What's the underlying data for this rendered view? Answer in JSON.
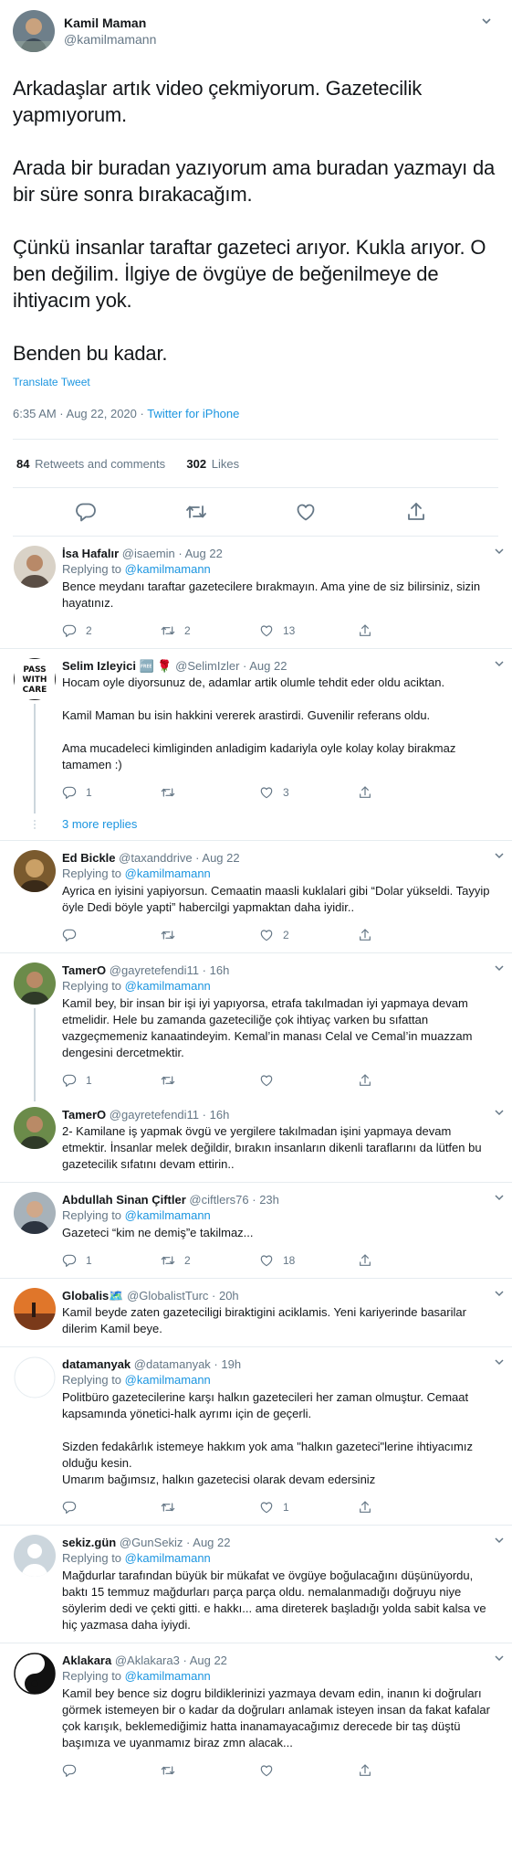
{
  "main_tweet": {
    "author_name": "Kamil Maman",
    "author_handle": "@kamilmamann",
    "paragraphs": [
      "Arkadaşlar artık video çekmiyorum. Gazetecilik yapmıyorum.",
      "Arada bir buradan yazıyorum ama buradan yazmayı da bir süre sonra bırakacağım.",
      "Çünkü insanlar taraftar gazeteci arıyor. Kukla arıyor. O ben değilim. İlgiye de övgüye de beğenilmeye de ihtiyacım yok.",
      "Benden bu kadar."
    ],
    "translate_label": "Translate Tweet",
    "timestamp": "6:35 AM · Aug 22, 2020 · ",
    "source": "Twitter for iPhone",
    "retweets_count": "84",
    "retweets_label": "Retweets and comments",
    "likes_count": "302",
    "likes_label": "Likes"
  },
  "replies": [
    {
      "name": "İsa Hafalır",
      "handle": "@isaemin",
      "date": "Aug 22",
      "replying_label": "Replying to",
      "replying_to": "@kamilmamann",
      "text": [
        "Bence meydanı taraftar gazetecilere bırakmayın. Ama yine de siz bilirsiniz, sizin hayatınız."
      ],
      "comments": "2",
      "retweets": "2",
      "likes": "13"
    },
    {
      "name": "Selim Izleyici 🆓 🌹",
      "handle": "@SelimIzler",
      "date": "Aug 22",
      "text": [
        "Hocam oyle diyorsunuz de, adamlar artik olumle tehdit eder oldu aciktan.",
        "Kamil Maman bu isin hakkini vererek arastirdi. Guvenilir referans oldu.",
        "Ama mucadeleci kimliginden anladigim kadariyla oyle kolay kolay birakmaz tamamen :)"
      ],
      "comments": "1",
      "retweets": "",
      "likes": "3"
    },
    {
      "name": "Ed Bickle",
      "handle": "@taxanddrive",
      "date": "Aug 22",
      "replying_label": "Replying to",
      "replying_to": "@kamilmamann",
      "text": [
        "Ayrica en iyisini yapiyorsun. Cemaatin maasli kuklalari gibi “Dolar yükseldi. Tayyip öyle Dedi böyle yapti” habercilgi yapmaktan daha iyidir.."
      ],
      "comments": "",
      "retweets": "",
      "likes": "2"
    },
    {
      "name": "TamerO",
      "handle": "@gayretefendi11",
      "date": "16h",
      "replying_label": "Replying to",
      "replying_to": "@kamilmamann",
      "text": [
        "Kamil bey, bir insan bir işi iyi yapıyorsa, etrafa takılmadan iyi yapmaya devam etmelidir. Hele bu zamanda gazeteciliğe çok ihtiyaç varken bu sıfattan vazgeçmemeniz kanaatindeyim. Kemal’in manası Celal ve Cemal’in muazzam dengesini dercetmektir."
      ],
      "comments": "1",
      "retweets": "",
      "likes": ""
    },
    {
      "name": "TamerO",
      "handle": "@gayretefendi11",
      "date": "16h",
      "text": [
        "2- Kamilane iş yapmak övgü ve yergilere takılmadan işini yapmaya devam etmektir. İnsanlar melek değildir, bırakın insanların dikenli taraflarını da lütfen bu gazetecilik sıfatını devam ettirin.."
      ],
      "comments": "",
      "retweets": "",
      "likes": ""
    },
    {
      "name": "Abdullah Sinan Çiftler",
      "handle": "@ciftlers76",
      "date": "23h",
      "replying_label": "Replying to",
      "replying_to": "@kamilmamann",
      "text": [
        "Gazeteci “kim ne demiş”e takilmaz..."
      ],
      "comments": "1",
      "retweets": "2",
      "likes": "18"
    },
    {
      "name": "Globalis🗺️",
      "handle": "@GlobalistTurc",
      "date": "20h",
      "text": [
        "Kamil beyde zaten gazeteciligi biraktigini aciklamis. Yeni kariyerinde basarilar dilerim Kamil beye."
      ],
      "comments": "",
      "retweets": "",
      "likes": ""
    },
    {
      "name": "datamanyak",
      "handle": "@datamanyak",
      "date": "19h",
      "replying_label": "Replying to",
      "replying_to": "@kamilmamann",
      "text": [
        "Politbüro gazetecilerine karşı halkın gazetecileri her zaman olmuştur. Cemaat kapsamında yönetici-halk ayrımı için de geçerli.",
        "Sizden fedakârlık istemeye hakkım yok ama \"halkın gazeteci\"lerine ihtiyacımız olduğu kesin.\nUmarım bağımsız, halkın gazetecisi olarak devam edersiniz"
      ],
      "comments": "",
      "retweets": "",
      "likes": "1"
    },
    {
      "name": "sekiz.gün",
      "handle": "@GunSekiz",
      "date": "Aug 22",
      "replying_label": "Replying to",
      "replying_to": "@kamilmamann",
      "text": [
        "Mağdurlar tarafından büyük bir mükafat ve övgüye boğulacağını düşünüyordu, baktı 15 temmuz mağdurları parça parça oldu. nemalanmadığı doğruyu niye söylerim dedi ve çekti gitti. e hakkı... ama direterek başladığı yolda sabit kalsa ve hiç yazmasa daha iyiydi."
      ],
      "comments": "",
      "retweets": "",
      "likes": ""
    },
    {
      "name": "Aklakara",
      "handle": "@Aklakara3",
      "date": "Aug 22",
      "replying_label": "Replying to",
      "replying_to": "@kamilmamann",
      "text": [
        "Kamil bey bence siz dogru bildiklerinizi yazmaya devam edin, inanın ki doğruları görmek istemeyen bir o kadar da doğruları anlamak isteyen insan da fakat kafalar çok karışık, beklemediğimiz hatta inanamayacağımız derecede bir taş düştü başımıza ve uyanmamız biraz zmn alacak..."
      ],
      "comments": "",
      "retweets": "",
      "likes": ""
    }
  ],
  "more_replies_label": "3 more replies",
  "icons": [
    "chevron-down-icon",
    "reply-icon",
    "retweet-icon",
    "like-icon",
    "share-icon"
  ],
  "colors": {
    "link": "#1b95e0",
    "secondary": "#657786",
    "text": "#14171a",
    "border": "#e6ecf0"
  }
}
